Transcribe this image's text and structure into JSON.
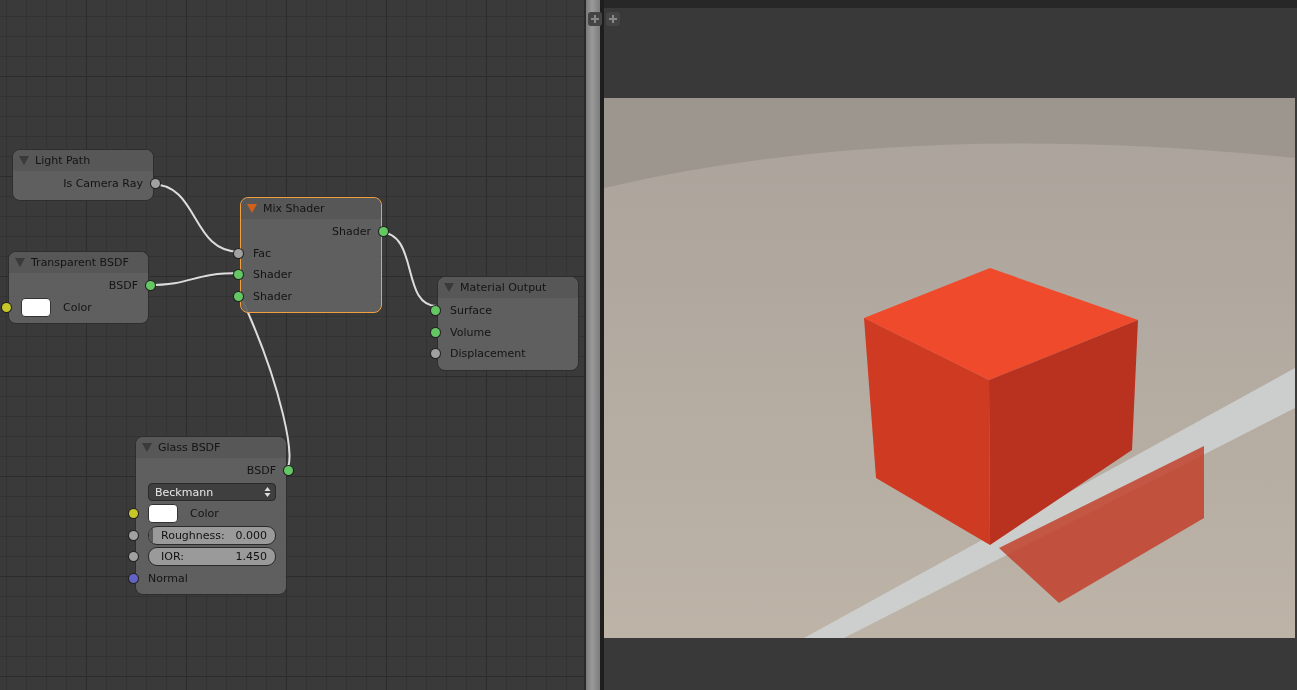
{
  "node_editor": {
    "nodes": [
      {
        "title": "Light Path",
        "selected": false,
        "rows": [
          {
            "kind": "output",
            "label": "Is Camera Ray",
            "color": "#a1a1a1"
          }
        ]
      },
      {
        "title": "Transparent BSDF",
        "selected": false,
        "rows": [
          {
            "kind": "output",
            "label": "BSDF",
            "color": "#63c763"
          },
          {
            "kind": "color",
            "label": "Color",
            "color": "#c7c729"
          }
        ]
      },
      {
        "title": "Mix Shader",
        "selected": true,
        "rows": [
          {
            "kind": "output",
            "label": "Shader",
            "color": "#63c763"
          },
          {
            "kind": "input",
            "label": "Fac",
            "color": "#a1a1a1"
          },
          {
            "kind": "input",
            "label": "Shader",
            "color": "#63c763"
          },
          {
            "kind": "input",
            "label": "Shader",
            "color": "#63c763"
          }
        ]
      },
      {
        "title": "Material Output",
        "selected": false,
        "rows": [
          {
            "kind": "input",
            "label": "Surface",
            "color": "#63c763"
          },
          {
            "kind": "input",
            "label": "Volume",
            "color": "#63c763"
          },
          {
            "kind": "input",
            "label": "Displacement",
            "color": "#a1a1a1"
          }
        ]
      },
      {
        "title": "Glass BSDF",
        "selected": false,
        "rows": [
          {
            "kind": "output",
            "label": "BSDF",
            "color": "#63c763"
          },
          {
            "kind": "dropdown",
            "value": "Beckmann"
          },
          {
            "kind": "color",
            "label": "Color",
            "color": "#c7c729"
          },
          {
            "kind": "slider",
            "label": "Roughness:",
            "value": "0.000",
            "level": 0,
            "color": "#a1a1a1"
          },
          {
            "kind": "number",
            "label": "IOR:",
            "value": "1.450",
            "color": "#a1a1a1"
          },
          {
            "kind": "input",
            "label": "Normal",
            "color": "#6363c7"
          }
        ]
      }
    ]
  }
}
